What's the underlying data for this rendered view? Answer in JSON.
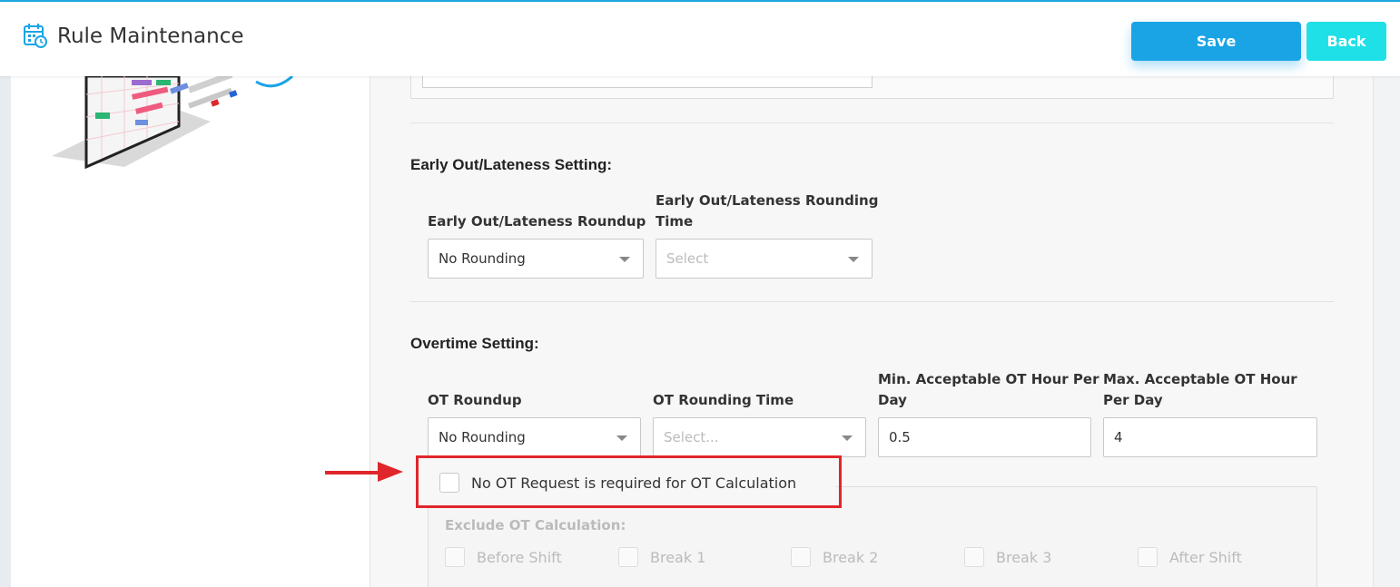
{
  "header": {
    "title": "Rule Maintenance",
    "save_label": "Save",
    "back_label": "Back",
    "accent_color": "#1aa4e6",
    "back_color": "#1ee0e6"
  },
  "early_out": {
    "section_title": "Early Out/Lateness Setting:",
    "roundup_label": "Early Out/Lateness Roundup",
    "roundup_value": "No Rounding",
    "rounding_time_label_line1": "Early Out/Lateness Rounding",
    "rounding_time_label_line2": "Time",
    "rounding_time_placeholder": "Select"
  },
  "overtime": {
    "section_title": "Overtime Setting:",
    "roundup_label": "OT Roundup",
    "roundup_value": "No Rounding",
    "rounding_time_label": "OT Rounding Time",
    "rounding_time_placeholder": "Select...",
    "min_label_line1": "Min. Acceptable OT Hour Per",
    "min_label_line2": "Day",
    "min_value": "0.5",
    "max_label_line1": "Max. Acceptable OT Hour",
    "max_label_line2": "Per Day",
    "max_value": "4",
    "no_ot_request_label": "No OT Request is required for OT Calculation",
    "exclude_title": "Exclude OT Calculation:",
    "exclude_items": [
      "Before Shift",
      "Break 1",
      "Break 2",
      "Break 3",
      "After Shift"
    ]
  },
  "annotation": {
    "highlight_color": "#e0262b"
  }
}
